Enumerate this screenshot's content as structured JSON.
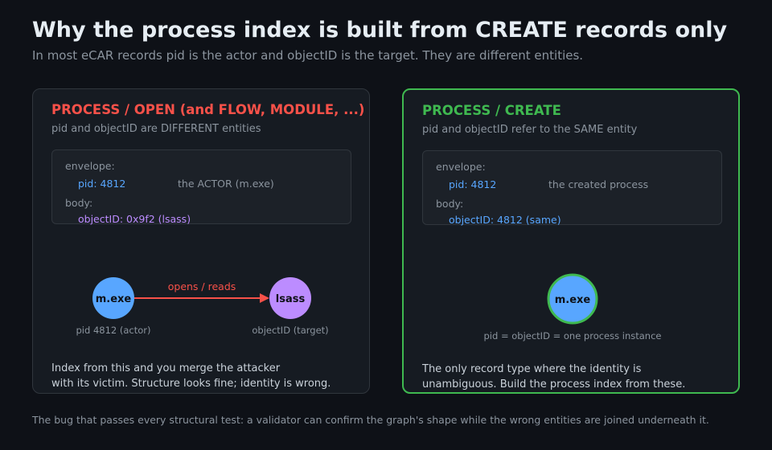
{
  "header": {
    "title": "Why the process index is built from CREATE records only",
    "subtitle": "In most eCAR records pid is the actor and objectID is the target. They are different entities."
  },
  "left_panel": {
    "title": "PROCESS / OPEN (and FLOW, MODULE, ...)",
    "subtitle": "pid and objectID are DIFFERENT entities",
    "envelope_label": "envelope:",
    "pid_value": "pid: 4812",
    "pid_note": "the ACTOR (m.exe)",
    "body_label": "body:",
    "object_value": "objectID: 0x9f2 (lsass)",
    "node_actor": "m.exe",
    "node_target": "lsass",
    "edge_label": "opens / reads",
    "actor_caption": "pid 4812 (actor)",
    "target_caption": "objectID (target)",
    "foot_line1": "Index from this and you merge the attacker",
    "foot_line2": "with its victim. Structure looks fine; identity is wrong."
  },
  "right_panel": {
    "title": "PROCESS / CREATE",
    "subtitle": "pid and objectID refer to the SAME entity",
    "envelope_label": "envelope:",
    "pid_value": "pid: 4812",
    "pid_note": "the created process",
    "body_label": "body:",
    "object_value": "objectID: 4812 (same)",
    "node": "m.exe",
    "node_caption": "pid = objectID = one process instance",
    "foot_line1": "The only record type where the identity is",
    "foot_line2": "unambiguous. Build the process index from these."
  },
  "footer": {
    "text": "The bug that passes every structural test: a validator can confirm the graph's shape while the wrong entities are joined underneath it."
  },
  "colors": {
    "background": "#0e1117",
    "panel": "#161b22",
    "danger": "#f85149",
    "success": "#3fb950",
    "actor_blue": "#58a6ff",
    "target_purple": "#bc8cff"
  }
}
